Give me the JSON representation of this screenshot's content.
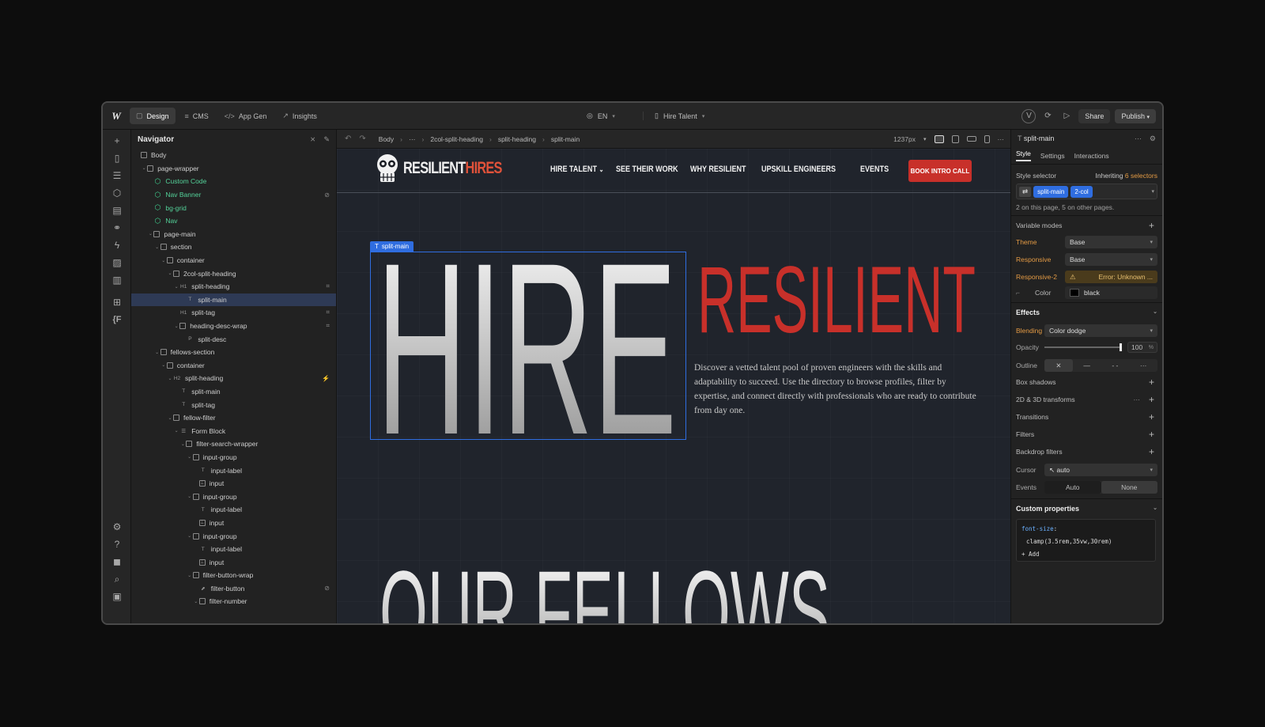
{
  "topbar": {
    "logo": "W",
    "nav": [
      {
        "label": "Design",
        "icon": "design-icon"
      },
      {
        "label": "CMS",
        "icon": "database-icon"
      },
      {
        "label": "App Gen",
        "icon": "code-icon"
      },
      {
        "label": "Insights",
        "icon": "chart-icon"
      }
    ],
    "locale": "EN",
    "page": "Hire Talent",
    "share_label": "Share",
    "publish_label": "Publish"
  },
  "navigator": {
    "title": "Navigator",
    "tree": [
      {
        "label": "Body",
        "depth": 0,
        "type": "box",
        "chev": ""
      },
      {
        "label": "page-wrapper",
        "depth": 1,
        "type": "box",
        "chev": "v"
      },
      {
        "label": "Custom Code",
        "depth": 2,
        "type": "comp",
        "chev": ""
      },
      {
        "label": "Nav Banner",
        "depth": 2,
        "type": "comp",
        "chev": "",
        "badge": "⊘"
      },
      {
        "label": "bg-grid",
        "depth": 2,
        "type": "comp",
        "chev": ""
      },
      {
        "label": "Nav",
        "depth": 2,
        "type": "comp",
        "chev": ""
      },
      {
        "label": "page-main",
        "depth": 2,
        "type": "box",
        "chev": "v"
      },
      {
        "label": "section",
        "depth": 3,
        "type": "box",
        "chev": "v"
      },
      {
        "label": "container",
        "depth": 4,
        "type": "box",
        "chev": "v"
      },
      {
        "label": "2col-split-heading",
        "depth": 5,
        "type": "box",
        "chev": "v"
      },
      {
        "label": "split-heading",
        "depth": 6,
        "type": "H1",
        "chev": "v",
        "badge": "⌗"
      },
      {
        "label": "split-main",
        "depth": 7,
        "type": "T",
        "chev": "",
        "selected": true
      },
      {
        "label": "split-tag",
        "depth": 6,
        "type": "H1",
        "chev": "",
        "badge": "⌗"
      },
      {
        "label": "heading-desc-wrap",
        "depth": 6,
        "type": "box",
        "chev": "v",
        "badge": "⌗"
      },
      {
        "label": "split-desc",
        "depth": 7,
        "type": "P",
        "chev": ""
      },
      {
        "label": "fellows-section",
        "depth": 3,
        "type": "box",
        "chev": "v"
      },
      {
        "label": "container",
        "depth": 4,
        "type": "box",
        "chev": "v"
      },
      {
        "label": "split-heading",
        "depth": 5,
        "type": "H2",
        "chev": "v",
        "badge": "⚡"
      },
      {
        "label": "split-main",
        "depth": 6,
        "type": "T",
        "chev": ""
      },
      {
        "label": "split-tag",
        "depth": 6,
        "type": "T",
        "chev": ""
      },
      {
        "label": "fellow-filter",
        "depth": 5,
        "type": "box",
        "chev": "v"
      },
      {
        "label": "Form Block",
        "depth": 6,
        "type": "form",
        "chev": "v"
      },
      {
        "label": "filter-search-wrapper",
        "depth": 7,
        "type": "box",
        "chev": "v"
      },
      {
        "label": "input-group",
        "depth": 8,
        "type": "box",
        "chev": "v"
      },
      {
        "label": "input-label",
        "depth": 9,
        "type": "T",
        "chev": ""
      },
      {
        "label": "input",
        "depth": 9,
        "type": "input",
        "chev": ""
      },
      {
        "label": "input-group",
        "depth": 8,
        "type": "box",
        "chev": "v"
      },
      {
        "label": "input-label",
        "depth": 9,
        "type": "T",
        "chev": ""
      },
      {
        "label": "input",
        "depth": 9,
        "type": "input",
        "chev": ""
      },
      {
        "label": "input-group",
        "depth": 8,
        "type": "box",
        "chev": "v"
      },
      {
        "label": "input-label",
        "depth": 9,
        "type": "T",
        "chev": ""
      },
      {
        "label": "input",
        "depth": 9,
        "type": "input",
        "chev": ""
      },
      {
        "label": "filter-button-wrap",
        "depth": 8,
        "type": "box",
        "chev": "v"
      },
      {
        "label": "filter-button",
        "depth": 9,
        "type": "btn",
        "chev": "",
        "badge": "⊘"
      },
      {
        "label": "filter-number",
        "depth": 9,
        "type": "box",
        "chev": "v"
      }
    ]
  },
  "canvas_bar": {
    "crumbs": [
      "Body",
      "···",
      "2col-split-heading",
      "split-heading",
      "split-main"
    ],
    "width_label": "1237px"
  },
  "site": {
    "brand_part1": "RESILIENT",
    "brand_part2": "HIRES",
    "links": [
      "HIRE TALENT",
      "SEE THEIR WORK",
      "WHY RESILIENT",
      "UPSKILL ENGINEERS",
      "EVENTS"
    ],
    "cta": "BOOK INTRO CALL",
    "selected_tag": "split-main",
    "heading_main": "HIRE",
    "heading_tag": "RESILIENT",
    "description": "Discover a vetted talent pool of proven engineers with the skills and adaptability to succeed. Use the directory to browse profiles, filter by expertise, and connect directly with professionals who are ready to contribute from day one.",
    "fellows_heading": "OUR FELLOWS"
  },
  "right_panel": {
    "element": "split-main",
    "tabs": [
      "Style",
      "Settings",
      "Interactions"
    ],
    "style_selector_label": "Style selector",
    "inheriting_text": "Inheriting",
    "inheriting_count": "6 selectors",
    "chips": [
      "split-main",
      "2-col"
    ],
    "usage_note": "2 on this page, 5 on other pages.",
    "variable_modes": "Variable modes",
    "theme_label": "Theme",
    "theme_value": "Base",
    "responsive_label": "Responsive",
    "responsive_value": "Base",
    "responsive2_label": "Responsive-2",
    "responsive2_value": "Error: Unknown ...",
    "color_label": "Color",
    "color_value": "black",
    "effects_title": "Effects",
    "blending_label": "Blending",
    "blending_value": "Color dodge",
    "opacity_label": "Opacity",
    "opacity_value": "100",
    "opacity_unit": "%",
    "outline_label": "Outline",
    "box_shadows": "Box shadows",
    "transforms": "2D & 3D transforms",
    "transitions": "Transitions",
    "filters": "Filters",
    "backdrop_filters": "Backdrop filters",
    "cursor_label": "Cursor",
    "cursor_value": "auto",
    "events_label": "Events",
    "events_auto": "Auto",
    "events_none": "None",
    "custom_props_title": "Custom properties",
    "custom_prop_name": "font-size",
    "custom_prop_value": "clamp(3.5rem,35vw,30rem)",
    "add_label": "Add"
  }
}
